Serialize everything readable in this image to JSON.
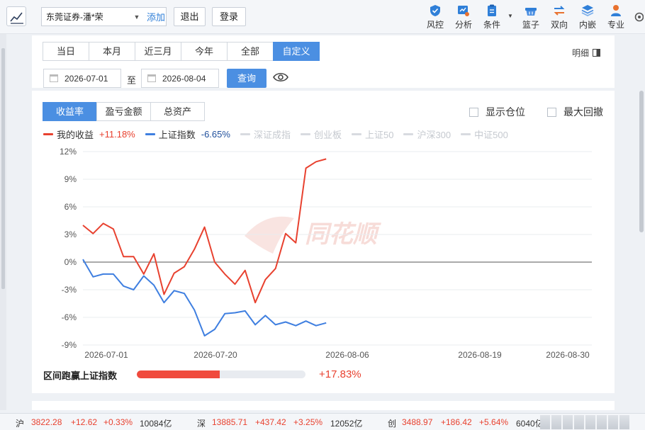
{
  "toolbar": {
    "account": "东莞证券-潘*荣",
    "add": "添加",
    "logout": "退出",
    "login": "登录",
    "tools": [
      {
        "label": "风控",
        "icon": "shield-icon",
        "color": "#2f7fd8"
      },
      {
        "label": "分析",
        "icon": "analysis-icon",
        "color": "#2f7fd8"
      },
      {
        "label": "条件",
        "icon": "clipboard-icon",
        "color": "#2f7fd8"
      },
      {
        "label": "篮子",
        "icon": "basket-icon",
        "color": "#2f7fd8"
      },
      {
        "label": "双向",
        "icon": "swap-icon",
        "color": "#e8712f"
      },
      {
        "label": "内嵌",
        "icon": "layers-icon",
        "color": "#2f7fd8"
      },
      {
        "label": "专业",
        "icon": "user-icon",
        "color": "#e8712f"
      }
    ]
  },
  "filters": {
    "periods": [
      "当日",
      "本月",
      "近三月",
      "今年",
      "全部",
      "自定义"
    ],
    "active_period": 5,
    "mode": "明细",
    "start_date": "2026-07-01",
    "to": "至",
    "end_date": "2026-08-04",
    "query": "查询"
  },
  "chart_panel": {
    "tabs": [
      "收益率",
      "盈亏金额",
      "总资产"
    ],
    "active_tab": 0,
    "show_position": "显示仓位",
    "max_drawdown": "最大回撤",
    "legend": [
      {
        "name": "我的收益",
        "value": "+11.18%",
        "color": "#e8412f",
        "value_color": "#e8412f",
        "active": true
      },
      {
        "name": "上证指数",
        "value": "-6.65%",
        "color": "#3f7fe0",
        "value_color": "#1f4f9c",
        "active": true
      },
      {
        "name": "深证成指",
        "value": "",
        "color": "#d8dbe0",
        "value_color": "",
        "active": false
      },
      {
        "name": "创业板",
        "value": "",
        "color": "#d8dbe0",
        "value_color": "",
        "active": false
      },
      {
        "name": "上证50",
        "value": "",
        "color": "#d8dbe0",
        "value_color": "",
        "active": false
      },
      {
        "name": "沪深300",
        "value": "",
        "color": "#d8dbe0",
        "value_color": "",
        "active": false
      },
      {
        "name": "中证500",
        "value": "",
        "color": "#d8dbe0",
        "value_color": "",
        "active": false
      }
    ],
    "watermark": "同花顺",
    "bench_label": "区间跑赢上证指数",
    "bench_value": "+17.83%",
    "bench_fraction": 0.49
  },
  "chart_data": {
    "type": "line",
    "y_ticks": [
      "12%",
      "9%",
      "6%",
      "3%",
      "0%",
      "-3%",
      "-6%",
      "-9%"
    ],
    "ylim": [
      -9,
      12
    ],
    "x_ticks": [
      "2026-07-01",
      "2026-07-20",
      "2026-08-06",
      "2026-08-19",
      "2026-08-30"
    ],
    "series": [
      {
        "name": "我的收益",
        "color": "#e8412f",
        "values": [
          4.0,
          3.1,
          4.2,
          3.6,
          0.6,
          0.6,
          -1.3,
          0.9,
          -3.5,
          -1.2,
          -0.5,
          1.4,
          3.8,
          0.0,
          -1.3,
          -2.4,
          -0.9,
          -4.4,
          -1.9,
          -0.7,
          3.1,
          2.1,
          10.2,
          10.9,
          11.2
        ]
      },
      {
        "name": "上证指数",
        "color": "#3f7fe0",
        "values": [
          0.3,
          -1.6,
          -1.3,
          -1.3,
          -2.6,
          -3.0,
          -1.5,
          -2.5,
          -4.4,
          -3.1,
          -3.4,
          -5.2,
          -8.0,
          -7.3,
          -5.6,
          -5.5,
          -5.3,
          -6.8,
          -5.8,
          -6.8,
          -6.5,
          -6.9,
          -6.4,
          -6.9,
          -6.6
        ]
      }
    ]
  },
  "status_bar": {
    "sh": {
      "label": "沪",
      "price": "3822.28",
      "change": "+12.62",
      "pct": "+0.33%",
      "volume": "10084亿"
    },
    "sz": {
      "label": "深",
      "price": "13885.71",
      "change": "+437.42",
      "pct": "+3.25%",
      "volume": "12052亿"
    },
    "cy": {
      "label": "创",
      "price": "3488.97",
      "change": "+186.42",
      "pct": "+5.64%",
      "volume": "6040亿"
    }
  }
}
